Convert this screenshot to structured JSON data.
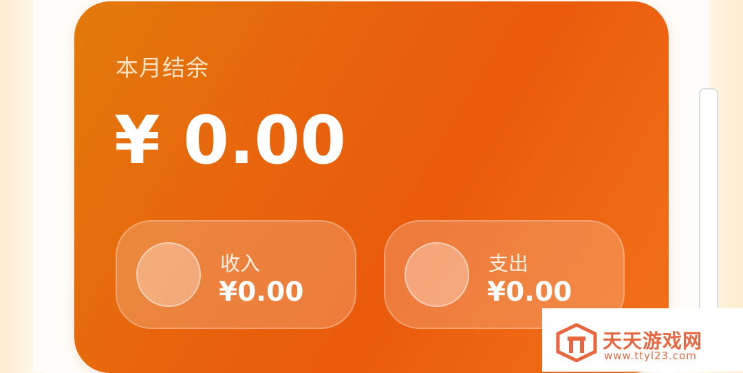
{
  "balance_card": {
    "title": "本月结余",
    "amount": "¥ 0.00"
  },
  "income": {
    "label": "收入",
    "value": "¥0.00",
    "icon": "income-icon"
  },
  "expense": {
    "label": "支出",
    "value": "¥0.00",
    "icon": "expense-icon"
  },
  "watermark": {
    "name": "天天游戏网",
    "url": "www.ttyl23.com"
  },
  "colors": {
    "card_orange": "#ea5b0c",
    "card_amber": "#e27a0c",
    "watermark": "#e8663f"
  }
}
